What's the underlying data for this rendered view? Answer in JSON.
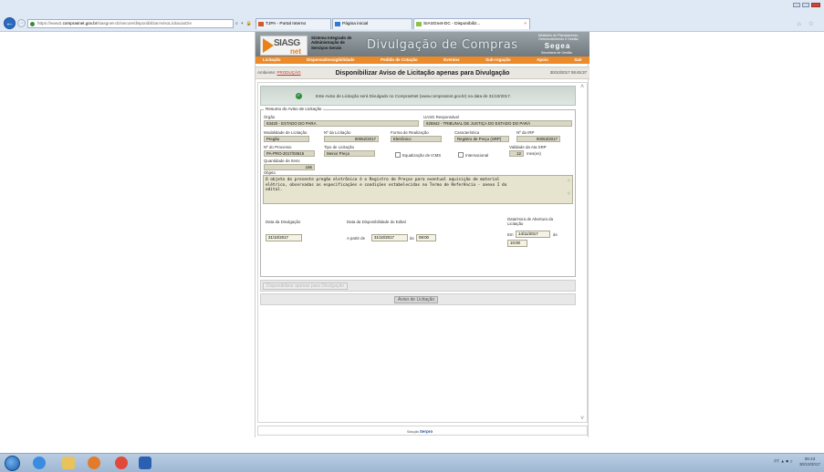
{
  "browser": {
    "url_prefix": "https://www2.",
    "url_host": "comprasnet.gov.br",
    "url_path": "/siasgnet-dc/secure/disponibilizarAvisoLicitacaoDiv",
    "url_tools": "⌕ ▾ 🔒 ↻",
    "tabs": [
      {
        "label": "TJPA - Portal Interno",
        "active": false
      },
      {
        "label": "Página inicial",
        "active": false
      },
      {
        "label": "SIASGnet-DC - Disponibiliz...",
        "active": true
      }
    ],
    "tab_close": "×"
  },
  "banner": {
    "logo_main": "SIASG",
    "logo_net": "net",
    "subtitle": "Sistema Integrado de Administração de Serviços Gerais",
    "title": "Divulgação de Compras",
    "ministerio": "Ministério do Planejamento, Desenvolvimento e Gestão",
    "segea": "Segea",
    "secretaria": "Secretaria de Gestão"
  },
  "menu": [
    "Licitação",
    "Dispensa/Inexigibilidade",
    "Pedido de Cotação",
    "Eventos",
    "Sub-rogação",
    "Apoio",
    "Sair"
  ],
  "header": {
    "ambiente_label": "Ambiente:",
    "ambiente_value": "PRODUÇÃO",
    "title": "Disponibilizar Aviso de Licitação apenas para Divulgação",
    "datetime": "30/10/2017 08:45:37"
  },
  "info": {
    "message": "Este Aviso de Licitação será Divulgado no ComprasNet (www.comprasnet.gov.br) na data de 31/10/2017."
  },
  "resumo": {
    "legend": "Resumo do Aviso de Licitação",
    "orgao_label": "Órgão",
    "orgao": "93420 - ESTADO DO PARA",
    "uasg_label": "UASG Responsável",
    "uasg": "925942 - TRIBUNAL DE JUSTIÇA DO ESTADO DO PARÁ",
    "modalidade_label": "Modalidade de Licitação",
    "modalidade": "Pregão",
    "numero_label": "Nº da Licitação",
    "numero": "00062/2017",
    "forma_label": "Forma de Realização",
    "forma": "Eletrônico",
    "caracteristica_label": "Característica",
    "caracteristica": "Registro de Preço (SRP)",
    "irp_label": "Nº da IRP",
    "irp": "00053/2017",
    "processo_label": "Nº do Processo",
    "processo": "PA-PRO-2017/03615",
    "tipo_label": "Tipo de Licitação",
    "tipo": "Menor Preço",
    "icms_label": "Equalização de ICMS",
    "internacional_label": "Internacional",
    "validade_label": "Validade da Ata SRP",
    "validade": "12",
    "validade_unit": "mes(es)",
    "qtd_label": "Quantidade de Itens",
    "qtd": "166",
    "objeto_label": "Objeto",
    "objeto_lines": [
      "O objeto do presente pregão eletrônico é o Registro de Preços para eventual aquisição de material",
      "elétrico, observadas as especificações e condições estabelecidas no Termo de Referência - anexo I do",
      "edital."
    ],
    "div_label": "Data da Divulgação",
    "div_date": "31/10/2017",
    "disp_label": "Data da Disponibilidade do Edital",
    "apartir": "A partir de",
    "disp_date": "31/10/2017",
    "as": "às",
    "disp_time": "08:00",
    "abertura_label_1": "Data/Hora de Abertura da",
    "abertura_label_2": "Licitação",
    "em": "Em",
    "abertura_date": "14/11/2017",
    "abertura_time": "10:00"
  },
  "buttons": {
    "disponibilizar": "Disponibilizar apenas para Divulgação",
    "aviso": "Aviso de Licitação"
  },
  "footer": {
    "logo_prefix": "Solução",
    "logo": "Serpro"
  },
  "taskbar": {
    "tray_lang": "PT",
    "time": "08:43",
    "date": "30/10/2017"
  }
}
